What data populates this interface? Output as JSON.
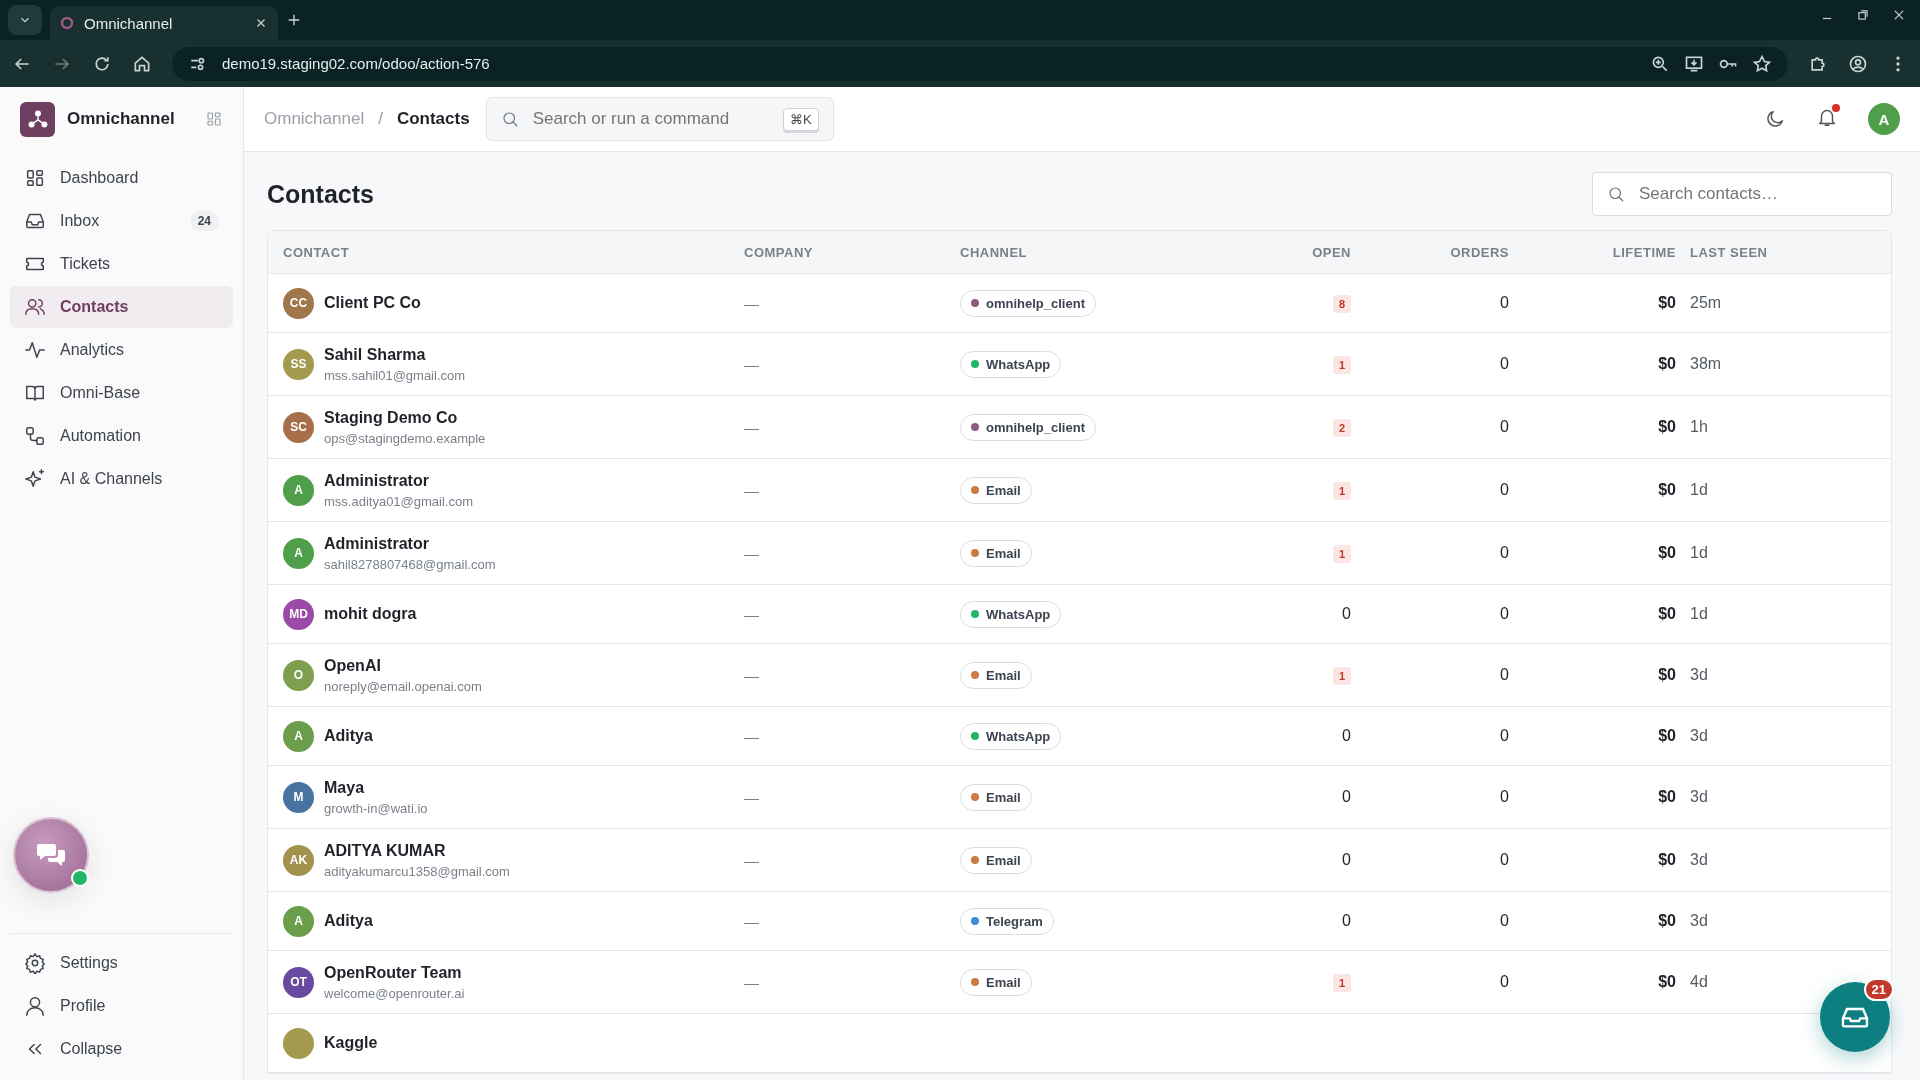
{
  "browser": {
    "tab_title": "Omnichannel",
    "url": "demo19.staging02.com/odoo/action-576"
  },
  "sidebar": {
    "app_name": "Omnichannel",
    "items": [
      {
        "label": "Dashboard",
        "selected": false
      },
      {
        "label": "Inbox",
        "selected": false,
        "count": "24"
      },
      {
        "label": "Tickets",
        "selected": false
      },
      {
        "label": "Contacts",
        "selected": true
      },
      {
        "label": "Analytics",
        "selected": false
      },
      {
        "label": "Omni-Base",
        "selected": false
      },
      {
        "label": "Automation",
        "selected": false
      },
      {
        "label": "AI & Channels",
        "selected": false
      }
    ],
    "bottom_items": [
      {
        "label": "Settings"
      },
      {
        "label": "Profile"
      },
      {
        "label": "Collapse"
      }
    ]
  },
  "topbar": {
    "breadcrumb": [
      "Omnichannel",
      "Contacts"
    ],
    "breadcrumb_separator": "/",
    "command_placeholder": "Search or run a command",
    "shortcut": "⌘K",
    "avatar": "A",
    "has_notification": true
  },
  "page": {
    "title": "Contacts",
    "search_placeholder": "Search contacts…"
  },
  "table": {
    "columns": [
      "CONTACT",
      "COMPANY",
      "CHANNEL",
      "OPEN",
      "ORDERS",
      "LIFETIME",
      "LAST SEEN"
    ],
    "rows": [
      {
        "initials": "CC",
        "color": "#a0764a",
        "name": "Client PC Co",
        "company": "—",
        "channel": {
          "label": "omnihelp_client",
          "color": "#8e5b80"
        },
        "open": "8",
        "open_highlight": true,
        "orders": "0",
        "lifetime": "$0",
        "last_seen": "25m"
      },
      {
        "initials": "SS",
        "color": "#a39a4e",
        "name": "Sahil Sharma",
        "email": "mss.sahil01@gmail.com",
        "company": "—",
        "channel": {
          "label": "WhatsApp",
          "color": "#22b566"
        },
        "open": "1",
        "open_highlight": true,
        "orders": "0",
        "lifetime": "$0",
        "last_seen": "38m"
      },
      {
        "initials": "SC",
        "color": "#a8704a",
        "name": "Staging Demo Co",
        "email": "ops@stagingdemo.example",
        "company": "—",
        "channel": {
          "label": "omnihelp_client",
          "color": "#8e5b80"
        },
        "open": "2",
        "open_highlight": true,
        "orders": "0",
        "lifetime": "$0",
        "last_seen": "1h"
      },
      {
        "initials": "A",
        "color": "#4e9e4a",
        "name": "Administrator",
        "email": "mss.aditya01@gmail.com",
        "company": "—",
        "channel": {
          "label": "Email",
          "color": "#c97a45"
        },
        "open": "1",
        "open_highlight": true,
        "orders": "0",
        "lifetime": "$0",
        "last_seen": "1d"
      },
      {
        "initials": "A",
        "color": "#4e9e4a",
        "name": "Administrator",
        "email": "sahil8278807468@gmail.com",
        "company": "—",
        "channel": {
          "label": "Email",
          "color": "#c97a45"
        },
        "open": "1",
        "open_highlight": true,
        "orders": "0",
        "lifetime": "$0",
        "last_seen": "1d"
      },
      {
        "initials": "MD",
        "color": "#9b4aa8",
        "name": "mohit dogra",
        "company": "—",
        "channel": {
          "label": "WhatsApp",
          "color": "#22b566"
        },
        "open": "0",
        "open_highlight": false,
        "orders": "0",
        "lifetime": "$0",
        "last_seen": "1d"
      },
      {
        "initials": "O",
        "color": "#7ea04e",
        "name": "OpenAI",
        "email": "noreply@email.openai.com",
        "company": "—",
        "channel": {
          "label": "Email",
          "color": "#c97a45"
        },
        "open": "1",
        "open_highlight": true,
        "orders": "0",
        "lifetime": "$0",
        "last_seen": "3d"
      },
      {
        "initials": "A",
        "color": "#6a9e4a",
        "name": "Aditya",
        "company": "—",
        "channel": {
          "label": "WhatsApp",
          "color": "#22b566"
        },
        "open": "0",
        "open_highlight": false,
        "orders": "0",
        "lifetime": "$0",
        "last_seen": "3d"
      },
      {
        "initials": "M",
        "color": "#4a72a0",
        "name": "Maya",
        "email": "growth-in@wati.io",
        "company": "—",
        "channel": {
          "label": "Email",
          "color": "#c97a45"
        },
        "open": "0",
        "open_highlight": false,
        "orders": "0",
        "lifetime": "$0",
        "last_seen": "3d"
      },
      {
        "initials": "AK",
        "color": "#a3924e",
        "name": "ADITYA KUMAR",
        "email": "adityakumarcu1358@gmail.com",
        "company": "—",
        "channel": {
          "label": "Email",
          "color": "#c97a45"
        },
        "open": "0",
        "open_highlight": false,
        "orders": "0",
        "lifetime": "$0",
        "last_seen": "3d"
      },
      {
        "initials": "A",
        "color": "#6a9e4a",
        "name": "Aditya",
        "company": "—",
        "channel": {
          "label": "Telegram",
          "color": "#3d8ad6"
        },
        "open": "0",
        "open_highlight": false,
        "orders": "0",
        "lifetime": "$0",
        "last_seen": "3d"
      },
      {
        "initials": "OT",
        "color": "#6a4aa0",
        "name": "OpenRouter Team",
        "email": "welcome@openrouter.ai",
        "company": "—",
        "channel": {
          "label": "Email",
          "color": "#c97a45"
        },
        "open": "1",
        "open_highlight": true,
        "orders": "0",
        "lifetime": "$0",
        "last_seen": "4d"
      },
      {
        "initials": "",
        "color": "#a39a4e",
        "name": "Kaggle",
        "partial": true
      }
    ]
  },
  "inbox_fab": {
    "count": "21"
  }
}
